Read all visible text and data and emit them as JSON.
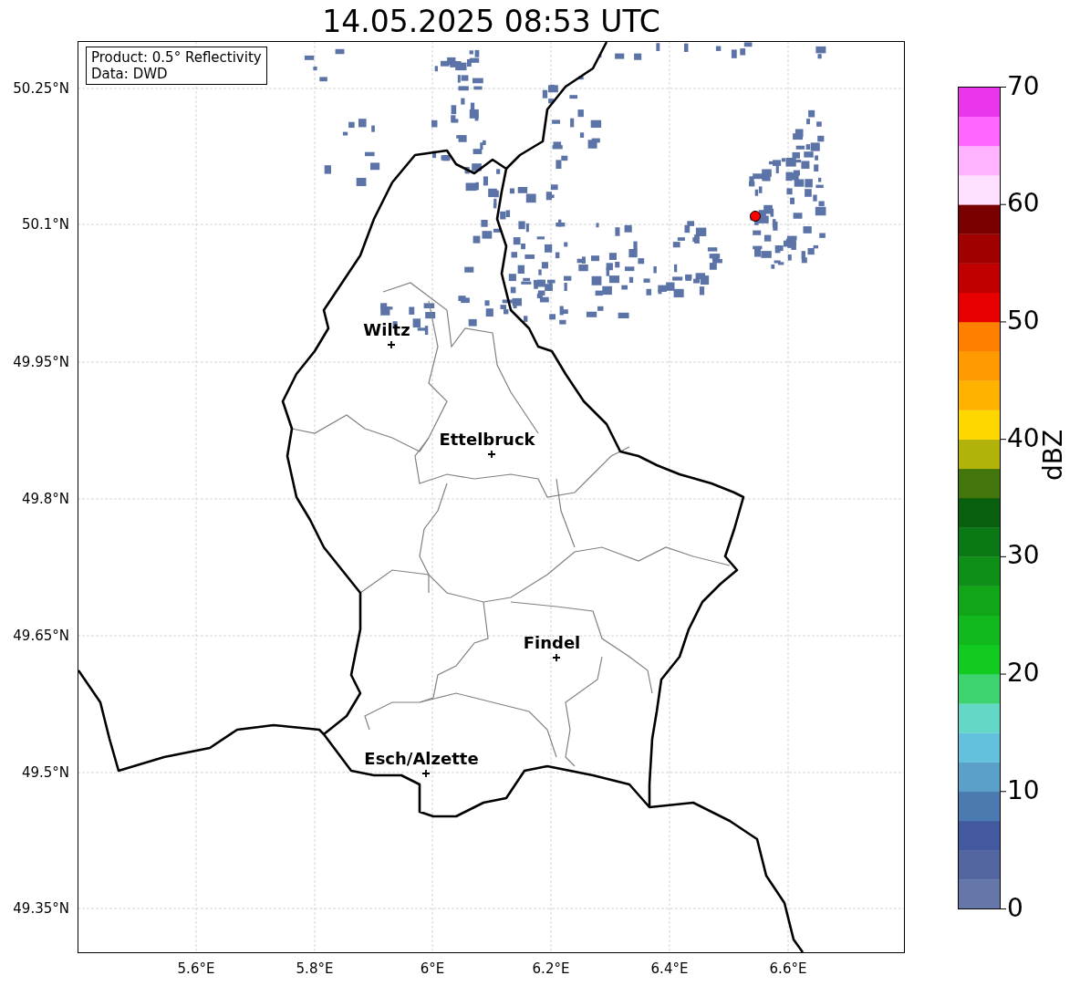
{
  "title": "14.05.2025 08:53 UTC",
  "map": {
    "info_box": [
      "Product: 0.5° Reflectivity",
      "Data: DWD"
    ],
    "lat_labels": [
      "50.25°N",
      "50.1°N",
      "49.95°N",
      "49.8°N",
      "49.65°N",
      "49.5°N",
      "49.35°N"
    ],
    "lon_labels": [
      "5.6°E",
      "5.8°E",
      "6°E",
      "6.2°E",
      "6.4°E",
      "6.6°E"
    ],
    "cities": [
      {
        "name": "Wiltz"
      },
      {
        "name": "Ettelbruck"
      },
      {
        "name": "Findel"
      },
      {
        "name": "Esch/Alzette"
      }
    ]
  },
  "colorbar": {
    "label": "dBZ",
    "ticks": [
      "70",
      "60",
      "50",
      "40",
      "30",
      "20",
      "10",
      "0"
    ],
    "bins": [
      {
        "color": "#6577a8"
      },
      {
        "color": "#5366a0"
      },
      {
        "color": "#42599e"
      },
      {
        "color": "#4b7ab0"
      },
      {
        "color": "#5aa0c9"
      },
      {
        "color": "#63c1de"
      },
      {
        "color": "#63d8c6"
      },
      {
        "color": "#3dd36e"
      },
      {
        "color": "#12cb20"
      },
      {
        "color": "#12b91c"
      },
      {
        "color": "#11a518"
      },
      {
        "color": "#0e8f17"
      },
      {
        "color": "#0b7816"
      },
      {
        "color": "#085f0e"
      },
      {
        "color": "#42760c"
      },
      {
        "color": "#b1b20a"
      },
      {
        "color": "#ffd700"
      },
      {
        "color": "#ffb300"
      },
      {
        "color": "#ff9a00"
      },
      {
        "color": "#ff7f00"
      },
      {
        "color": "#e60000"
      },
      {
        "color": "#c00000"
      },
      {
        "color": "#a00000"
      },
      {
        "color": "#780000"
      },
      {
        "color": "#ffe0ff"
      },
      {
        "color": "#ffb3ff"
      },
      {
        "color": "#ff66ff"
      },
      {
        "color": "#e936ea"
      }
    ]
  }
}
